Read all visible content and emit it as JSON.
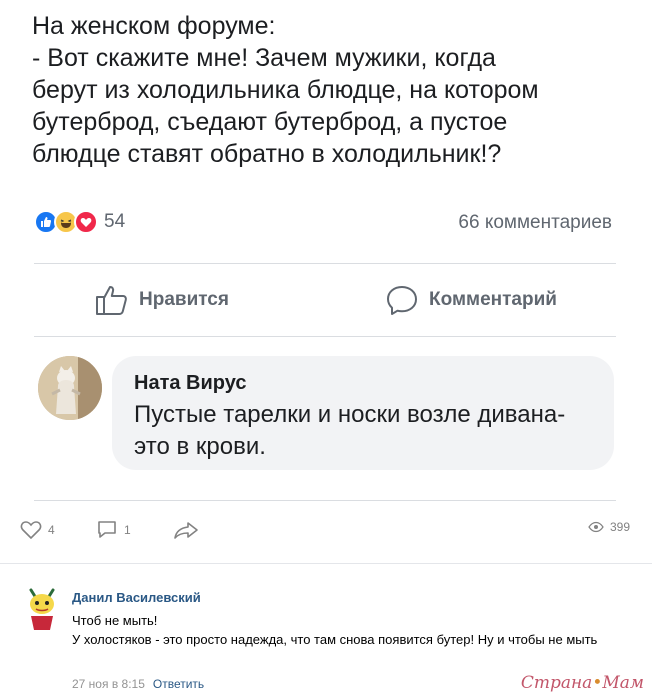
{
  "post": {
    "text": "На женском форуме:\n- Вот скажите мне! Зачем мужики, когда\nберут из холодильника блюдце, на котором\nбутерброд, съедают бутерброд, а пустое\nблюдце ставят обратно в холодильник!?"
  },
  "reactions": {
    "icons": [
      "like-icon",
      "haha-icon",
      "love-icon"
    ],
    "count": "54"
  },
  "comments_count": "66 комментариев",
  "actions": {
    "like_label": "Нравится",
    "comment_label": "Комментарий"
  },
  "top_comment": {
    "author": "Ната Вирус",
    "text": "Пустые тарелки и носки возле дивана- это в крови."
  },
  "vk_stats": {
    "likes": "4",
    "comments": "1",
    "views": "399"
  },
  "vk_comment": {
    "author": "Данил Василевский",
    "text": "Чтоб не мыть!\nУ холостяков - это просто надежда, что там снова появится бутер! Ну и чтобы не мыть",
    "date": "27 ноя в 8:15",
    "reply_label": "Ответить"
  },
  "watermark": "Страна Мам",
  "colors": {
    "fb_blue": "#1877f2",
    "vk_link": "#2a5885"
  }
}
